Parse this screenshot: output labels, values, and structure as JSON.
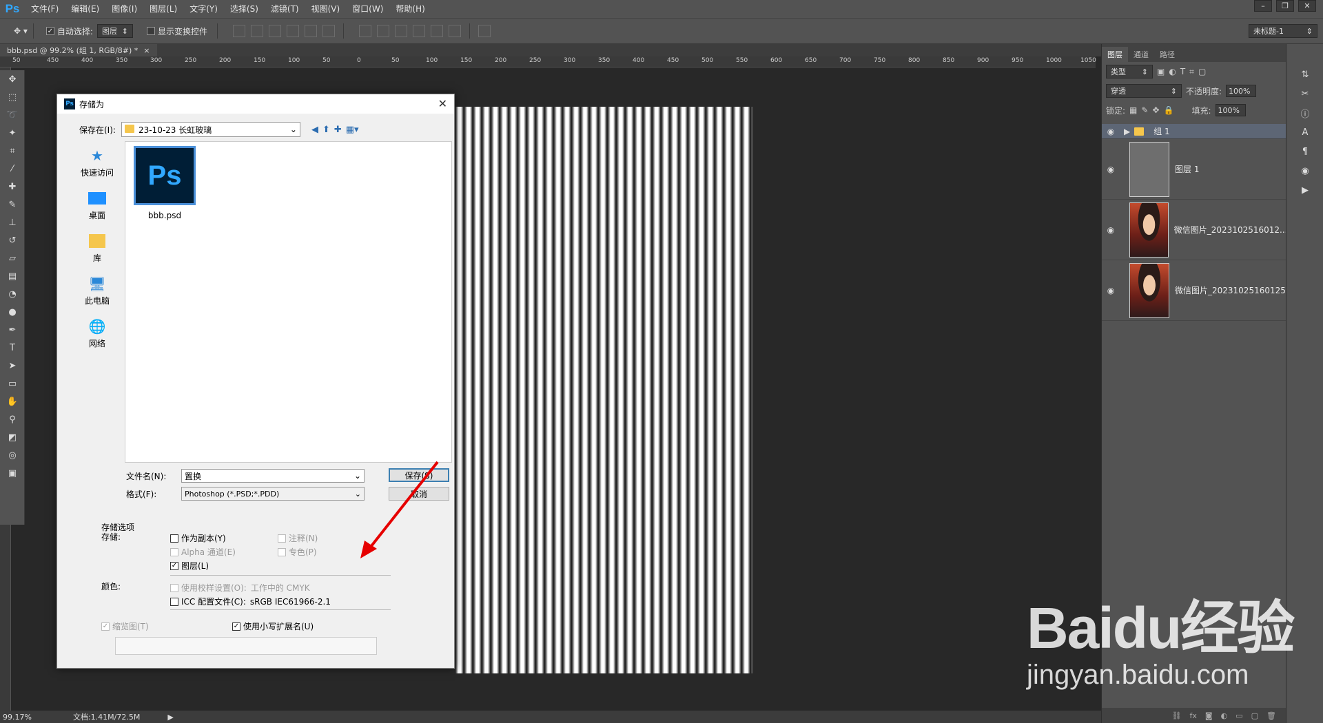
{
  "app": {
    "logo": "Ps"
  },
  "menu": [
    "文件(F)",
    "编辑(E)",
    "图像(I)",
    "图层(L)",
    "文字(Y)",
    "选择(S)",
    "滤镜(T)",
    "视图(V)",
    "窗口(W)",
    "帮助(H)"
  ],
  "options": {
    "auto_select_label": "自动选择:",
    "auto_select_value": "图层",
    "show_transform_label": "显示变换控件",
    "workspace": "未标题-1"
  },
  "doc_tab": {
    "label": "bbb.psd @ 99.2% (组 1, RGB/8#) *",
    "close": "×"
  },
  "ruler_ticks": [
    "50",
    "450",
    "400",
    "350",
    "300",
    "250",
    "200",
    "150",
    "100",
    "50",
    "0",
    "50",
    "100",
    "150",
    "200",
    "250",
    "300",
    "350",
    "400",
    "450",
    "500",
    "550",
    "600",
    "650",
    "700",
    "750",
    "800",
    "850",
    "900",
    "950",
    "1000",
    "1050"
  ],
  "status": {
    "zoom": "99.17%",
    "doc": "文档:1.41M/72.5M"
  },
  "panel": {
    "tabs": [
      "图层",
      "通道",
      "路径"
    ],
    "filter_label": "类型",
    "blend_mode": "穿透",
    "opacity_label": "不透明度:",
    "opacity_value": "100%",
    "lock_label": "锁定:",
    "fill_label": "填充:",
    "fill_value": "100%",
    "layers": [
      {
        "name": "组 1",
        "type": "group"
      },
      {
        "name": "图层 1",
        "type": "gray"
      },
      {
        "name": "微信图片_2023102516012...",
        "type": "image"
      },
      {
        "name": "微信图片_20231025160125",
        "type": "image"
      }
    ]
  },
  "dialog": {
    "title": "存储为",
    "save_in_label": "保存在(I):",
    "save_in_value": "23-10-23 长虹玻璃",
    "places": [
      "快速访问",
      "桌面",
      "库",
      "此电脑",
      "网络"
    ],
    "file": {
      "icon_text": "Ps",
      "name": "bbb.psd"
    },
    "filename_label": "文件名(N):",
    "filename_value": "置换",
    "format_label": "格式(F):",
    "format_value": "Photoshop (*.PSD;*.PDD)",
    "save_button": "保存(S)",
    "cancel_button": "取消",
    "options_title": "存储选项",
    "save_label": "存储:",
    "as_copy": "作为副本(Y)",
    "notes": "注释(N)",
    "alpha": "Alpha 通道(E)",
    "spot": "专色(P)",
    "layers": "图层(L)",
    "color_label": "颜色:",
    "use_proof": "使用校样设置(O):",
    "proof_value": "工作中的 CMYK",
    "icc": "ICC 配置文件(C):",
    "icc_value": "sRGB IEC61966-2.1",
    "thumbnail": "缩览图(T)",
    "lowercase_ext": "使用小写扩展名(U)"
  },
  "watermark": {
    "logo": "Baidu经验",
    "url": "jingyan.baidu.com"
  }
}
